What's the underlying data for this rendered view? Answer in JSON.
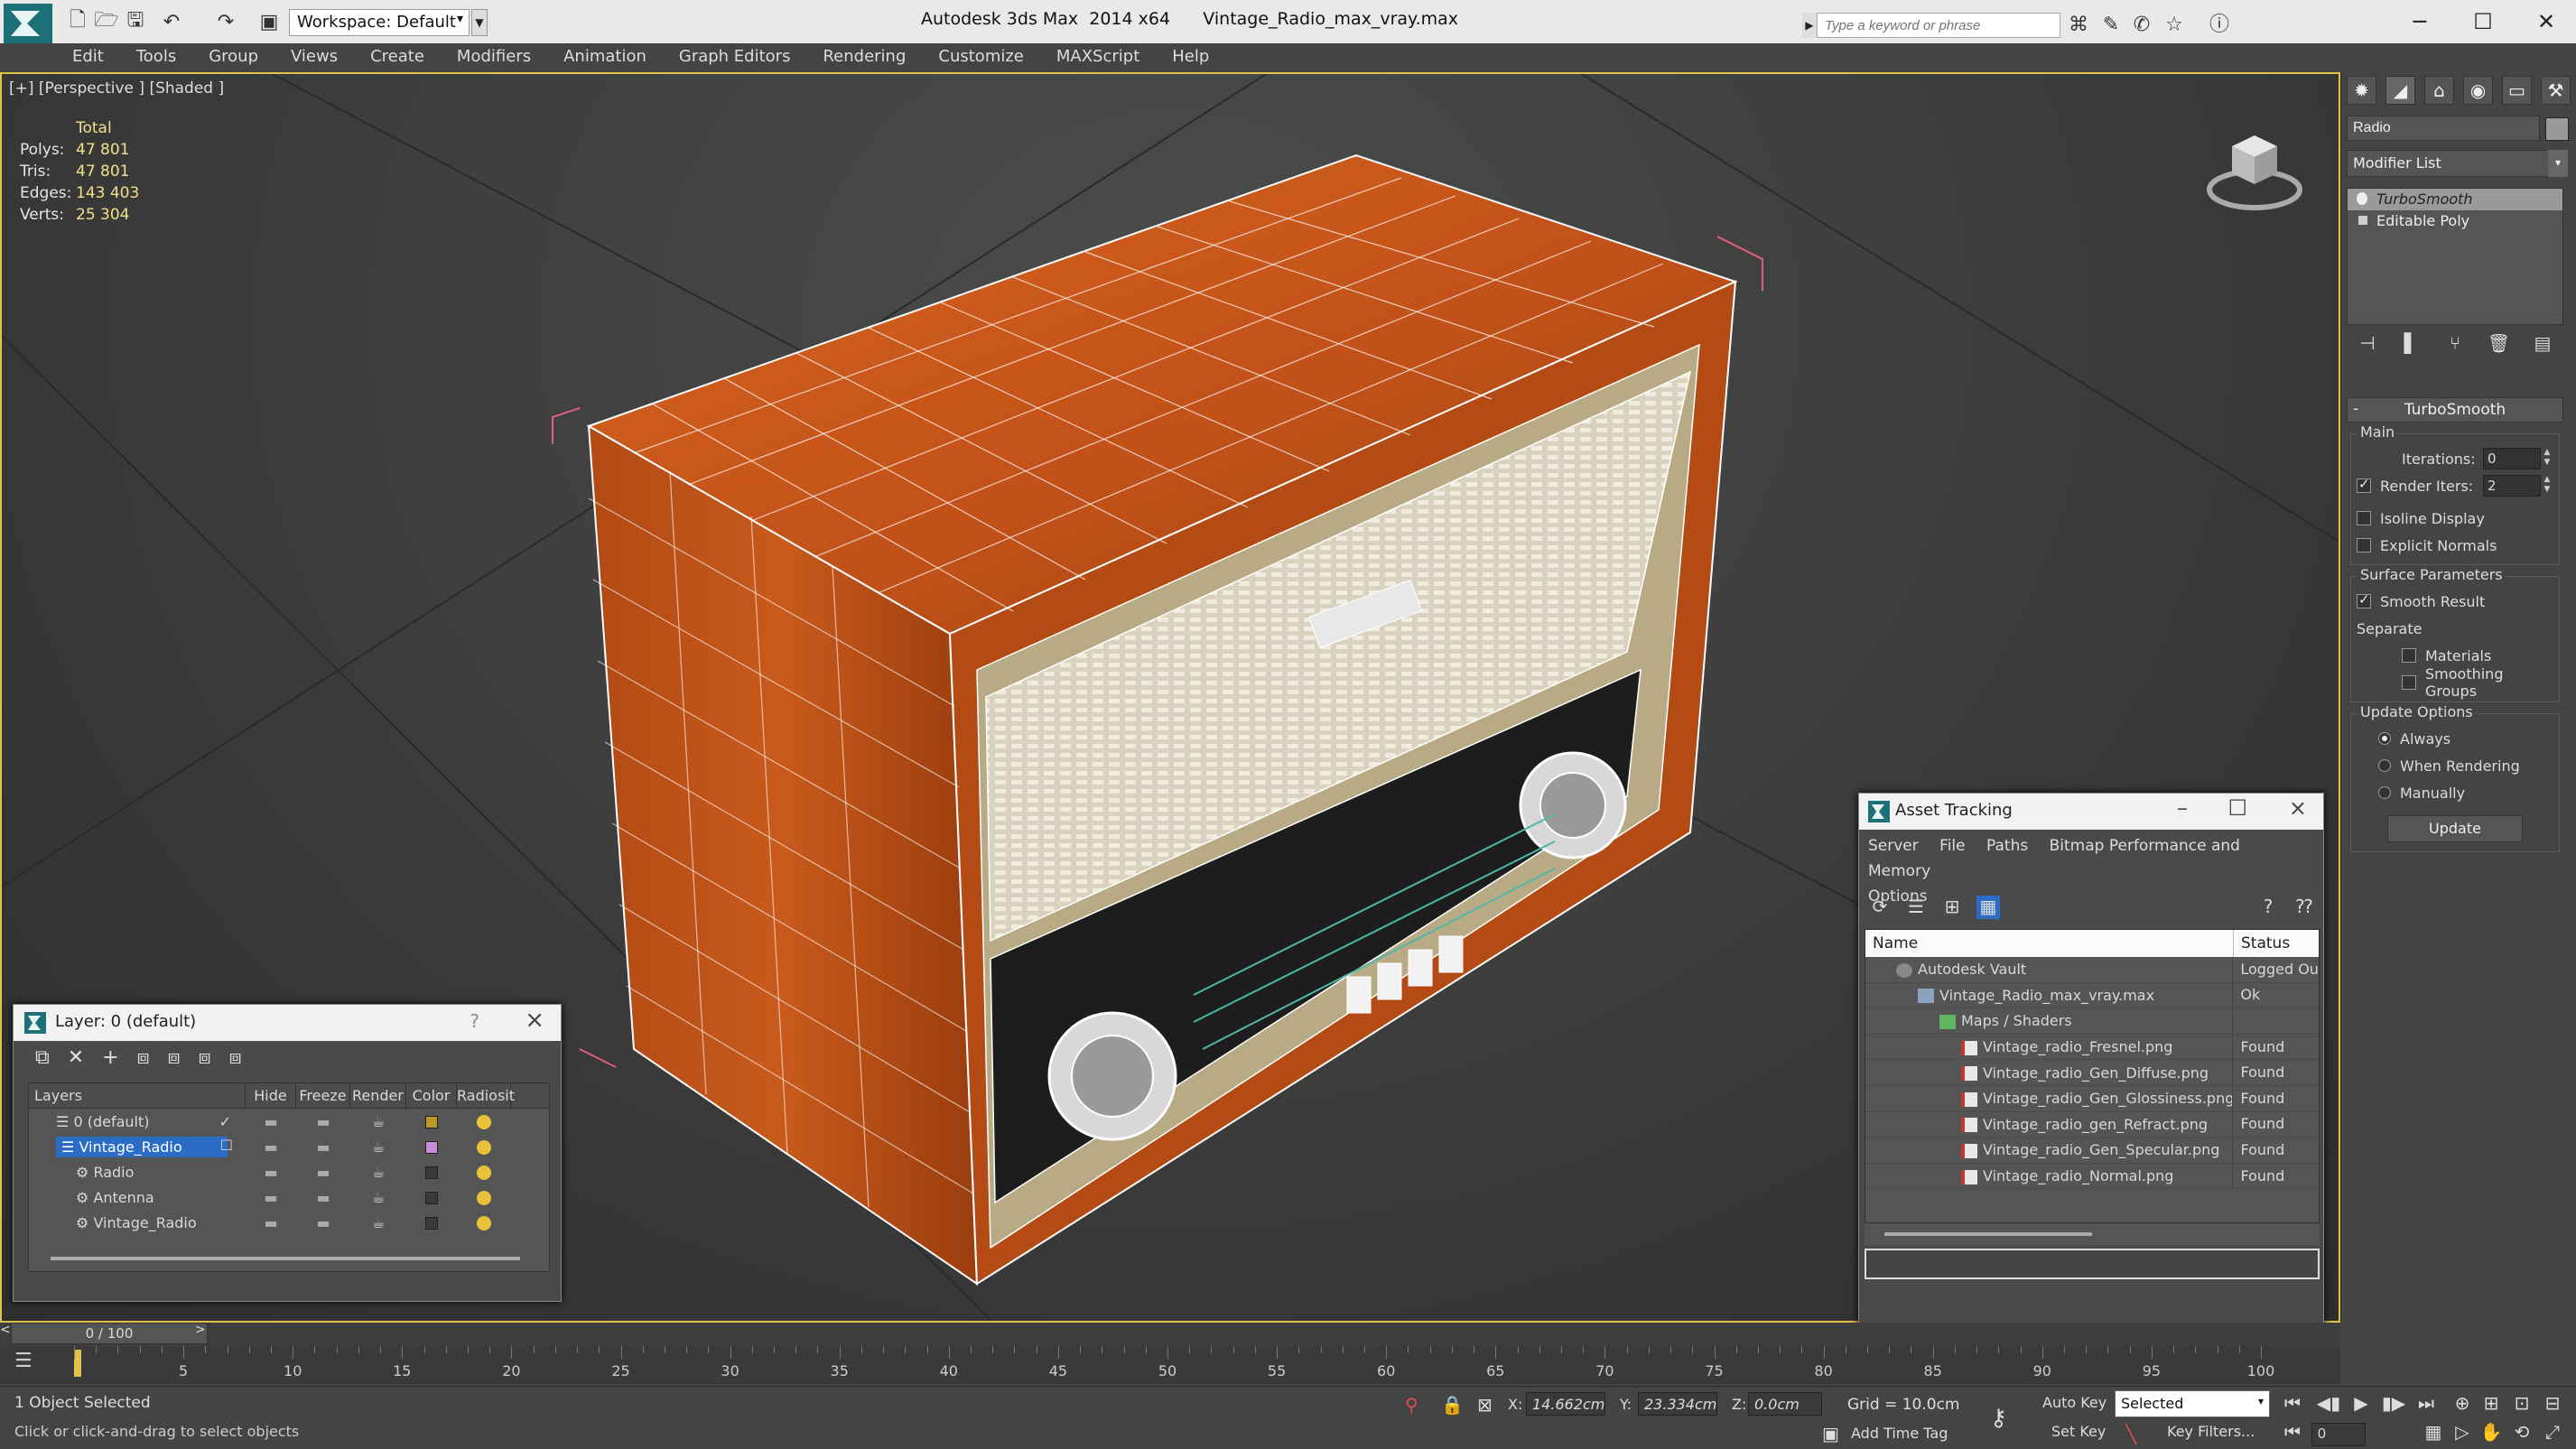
{
  "titlebar": {
    "workspace": "Workspace: Default",
    "app_title": "Autodesk 3ds Max  2014 x64      Vintage_Radio_max_vray.max",
    "search_placeholder": "Type a keyword or phrase"
  },
  "menu": [
    "Edit",
    "Tools",
    "Group",
    "Views",
    "Create",
    "Modifiers",
    "Animation",
    "Graph Editors",
    "Rendering",
    "Customize",
    "MAXScript",
    "Help"
  ],
  "viewport": {
    "label": "[+] [Perspective ] [Shaded ]",
    "stats": {
      "header": "Total",
      "rows": [
        {
          "k": "Polys:",
          "v": "47 801"
        },
        {
          "k": "Tris:",
          "v": "47 801"
        },
        {
          "k": "Edges:",
          "v": "143 403"
        },
        {
          "k": "Verts:",
          "v": "25 304"
        }
      ]
    }
  },
  "command_panel": {
    "object_name": "Radio",
    "modifier_list": "Modifier List",
    "stack": [
      "TurboSmooth",
      "Editable Poly"
    ],
    "turbosmooth": {
      "title": "TurboSmooth",
      "main": "Main",
      "iterations_label": "Iterations:",
      "iterations": "0",
      "render_iters_label": "Render Iters:",
      "render_iters": "2",
      "isoline": "Isoline Display",
      "explicit": "Explicit Normals",
      "surface": "Surface Parameters",
      "smooth": "Smooth Result",
      "separate": "Separate",
      "materials": "Materials",
      "smoothing": "Smoothing Groups",
      "update_options": "Update Options",
      "always": "Always",
      "when_rendering": "When Rendering",
      "manually": "Manually",
      "update": "Update"
    }
  },
  "layer_window": {
    "title": "Layer: 0 (default)",
    "columns": [
      "Layers",
      "Hide",
      "Freeze",
      "Render",
      "Color",
      "Radiosit"
    ],
    "rows": [
      {
        "name": "0 (default)",
        "color": "#b89a2a",
        "level": 1,
        "selected": false
      },
      {
        "name": "Vintage_Radio",
        "color": "#c98ad8",
        "level": 1,
        "selected": true
      },
      {
        "name": "Radio",
        "color": "#3a3a3a",
        "level": 2,
        "selected": false
      },
      {
        "name": "Antenna",
        "color": "#3a3a3a",
        "level": 2,
        "selected": false
      },
      {
        "name": "Vintage_Radio",
        "color": "#3a3a3a",
        "level": 2,
        "selected": false
      }
    ]
  },
  "asset_window": {
    "title": "Asset Tracking",
    "menu": [
      "Server",
      "File",
      "Paths",
      "Bitmap Performance and Memory",
      "Options"
    ],
    "columns": [
      "Name",
      "Status"
    ],
    "rows": [
      {
        "name": "Autodesk Vault",
        "status": "Logged Ou",
        "level": 1
      },
      {
        "name": "Vintage_Radio_max_vray.max",
        "status": "Ok",
        "level": 2
      },
      {
        "name": "Maps / Shaders",
        "status": "",
        "level": 3
      },
      {
        "name": "Vintage_radio_Fresnel.png",
        "status": "Found",
        "level": 4
      },
      {
        "name": "Vintage_radio_Gen_Diffuse.png",
        "status": "Found",
        "level": 4
      },
      {
        "name": "Vintage_radio_Gen_Glossiness.png",
        "status": "Found",
        "level": 4
      },
      {
        "name": "Vintage_radio_gen_Refract.png",
        "status": "Found",
        "level": 4
      },
      {
        "name": "Vintage_radio_Gen_Specular.png",
        "status": "Found",
        "level": 4
      },
      {
        "name": "Vintage_radio_Normal.png",
        "status": "Found",
        "level": 4
      }
    ]
  },
  "timeline": {
    "slider": "0 / 100",
    "ticks": [
      "5",
      "10",
      "15",
      "20",
      "25",
      "30",
      "35",
      "40",
      "45",
      "50",
      "55",
      "60",
      "65",
      "70",
      "75",
      "80",
      "85",
      "90",
      "95",
      "100"
    ]
  },
  "status": {
    "selection": "1 Object Selected",
    "prompt": "Click or click-and-drag to select objects",
    "x_label": "X:",
    "x": "14.662cm",
    "y_label": "Y:",
    "y": "23.334cm",
    "z_label": "Z:",
    "z": "0.0cm",
    "grid": "Grid = 10.0cm",
    "auto_key": "Auto Key",
    "set_key": "Set Key",
    "selected": "Selected",
    "key_filters": "Key Filters...",
    "add_time_tag": "Add Time Tag",
    "frame": "0"
  },
  "colors": {
    "wood": "#c7561a",
    "viewport_border": "#e1c24a",
    "selection": "#2a6cc6"
  }
}
